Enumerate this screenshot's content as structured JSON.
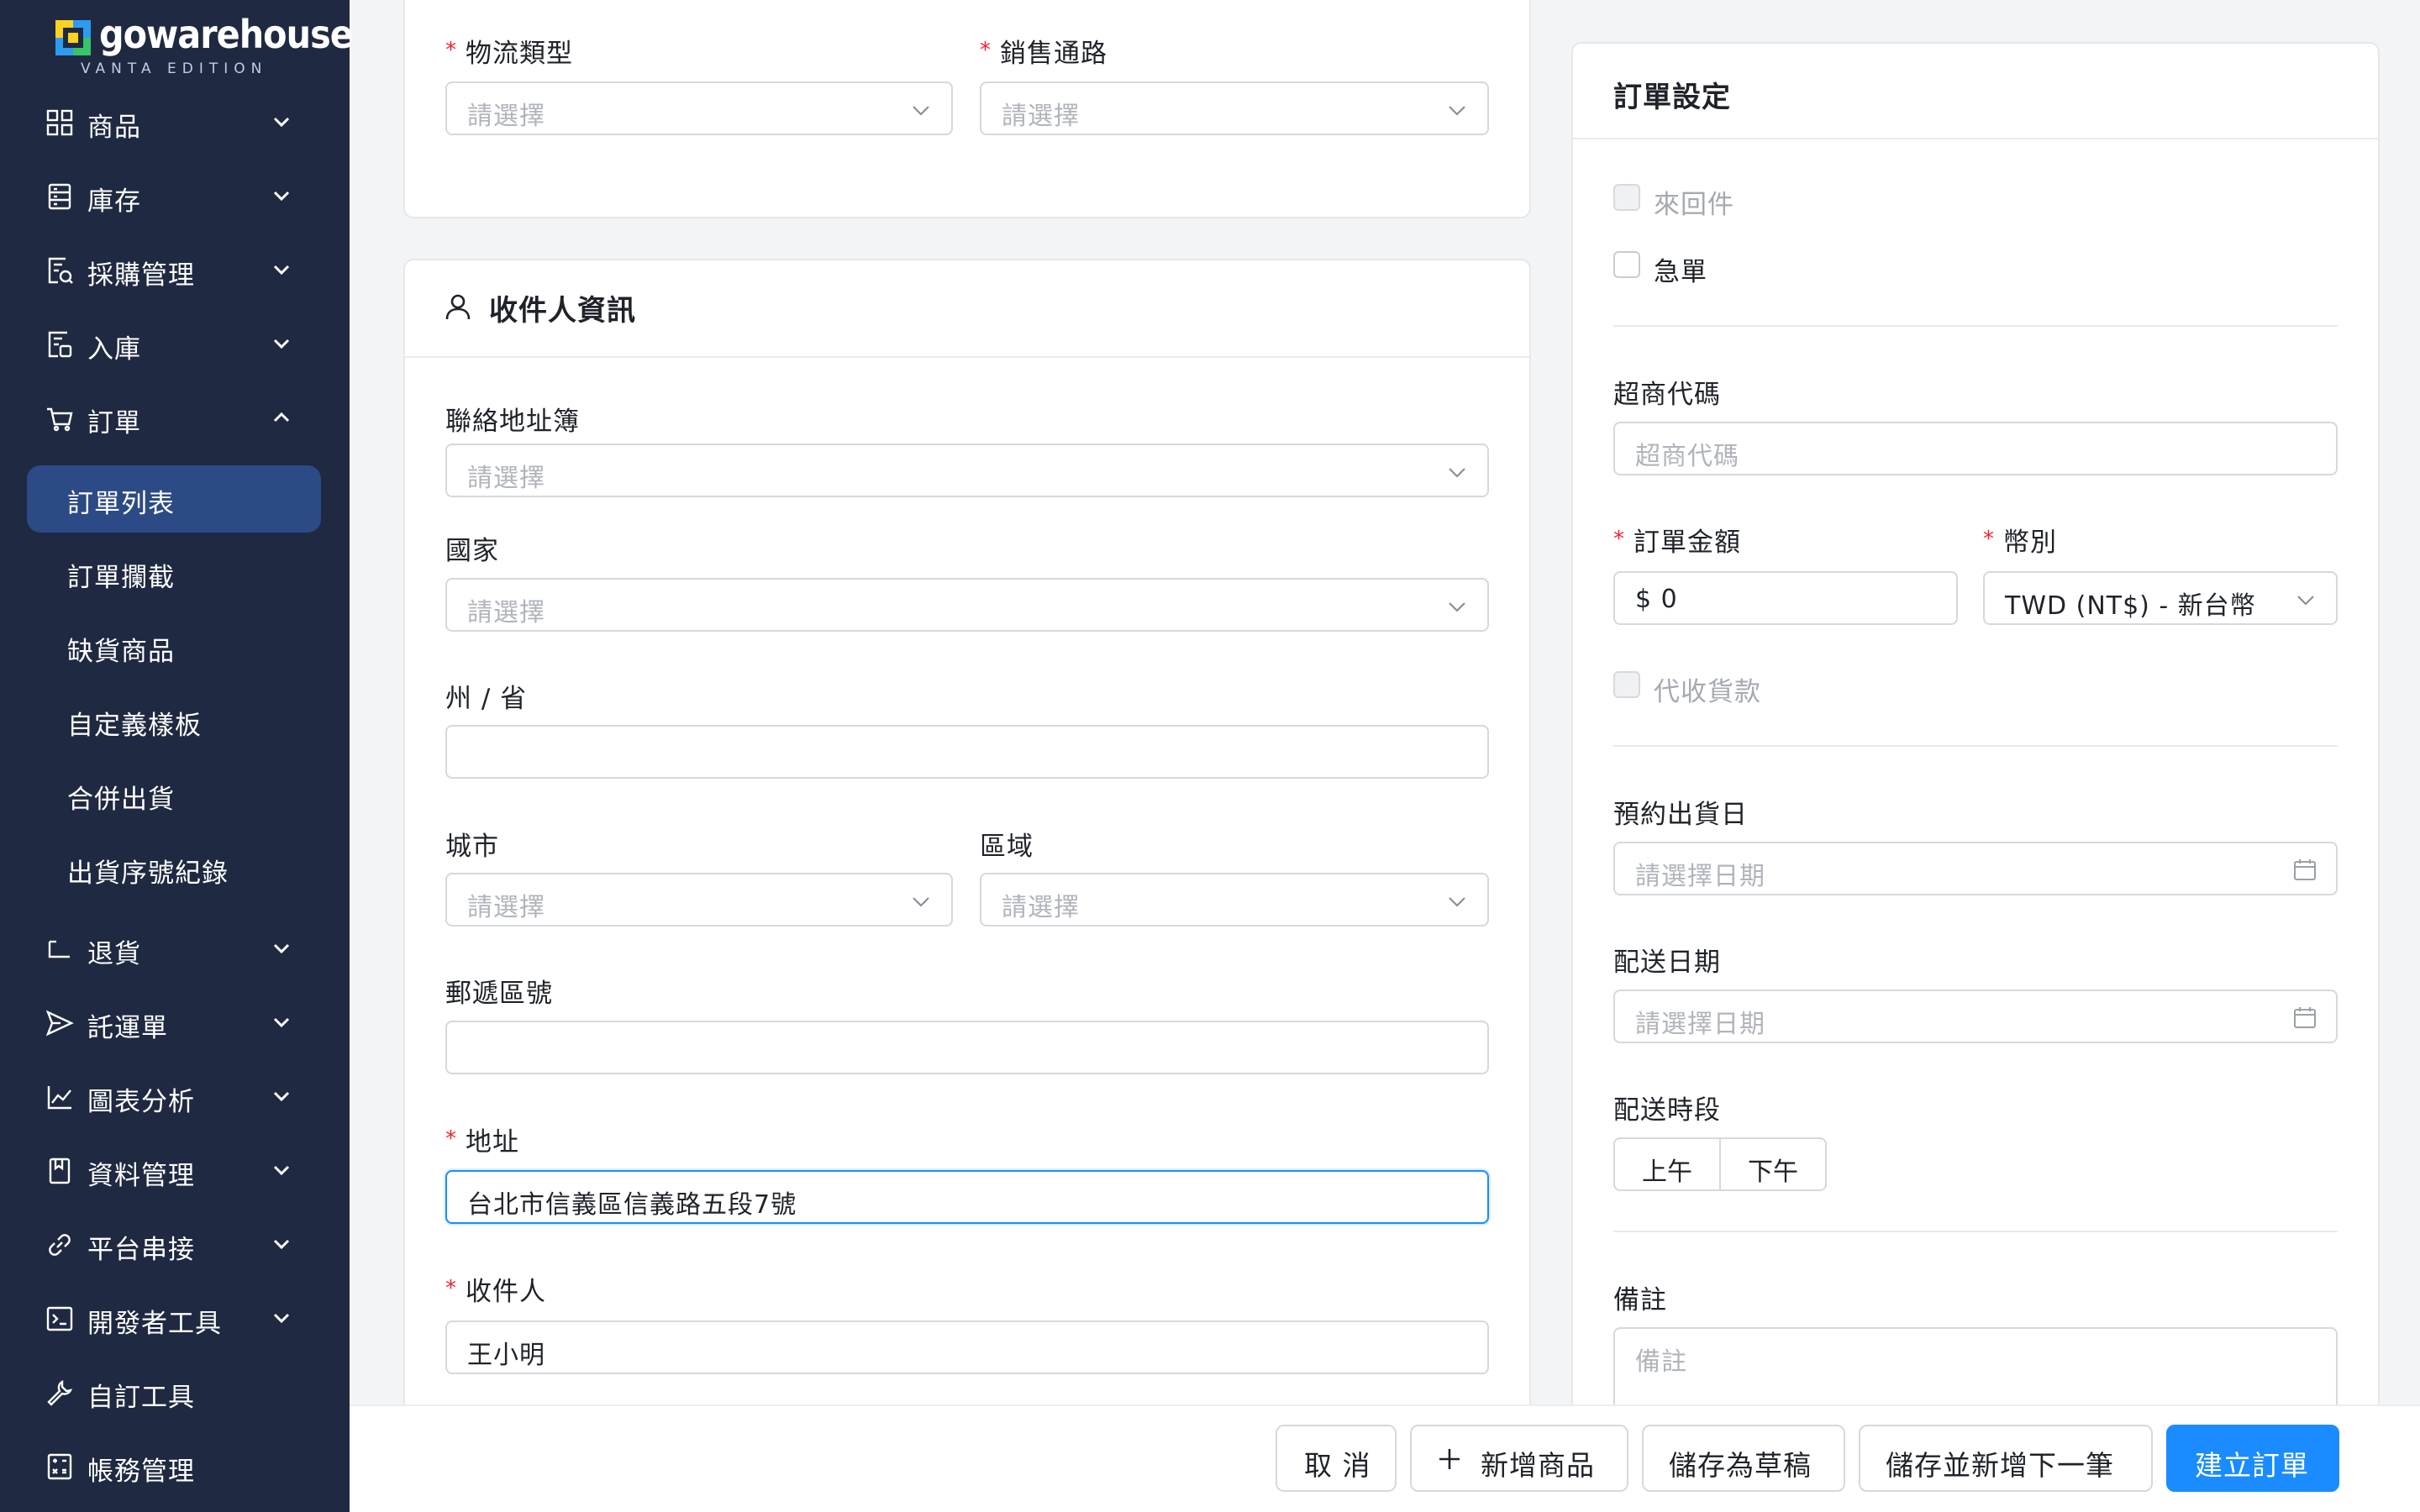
{
  "brand": {
    "name": "gowarehouse",
    "edition": "VANTA EDITION"
  },
  "sidebar": {
    "items": [
      {
        "label": "商品",
        "icon": "grid-icon"
      },
      {
        "label": "庫存",
        "icon": "inventory-icon"
      },
      {
        "label": "採購管理",
        "icon": "purchase-icon"
      },
      {
        "label": "入庫",
        "icon": "inbound-icon"
      },
      {
        "label": "訂單",
        "icon": "cart-icon"
      },
      {
        "label": "退貨",
        "icon": "return-icon"
      },
      {
        "label": "託運單",
        "icon": "send-icon"
      },
      {
        "label": "圖表分析",
        "icon": "chart-icon"
      },
      {
        "label": "資料管理",
        "icon": "book-icon"
      },
      {
        "label": "平台串接",
        "icon": "link-icon"
      },
      {
        "label": "開發者工具",
        "icon": "terminal-icon"
      },
      {
        "label": "自訂工具",
        "icon": "wrench-icon"
      },
      {
        "label": "帳務管理",
        "icon": "calculator-icon"
      }
    ],
    "order_sub": [
      "訂單列表",
      "訂單攔截",
      "缺貨商品",
      "自定義樣板",
      "合併出貨",
      "出貨序號紀錄"
    ]
  },
  "logistics": {
    "type_label": "物流類型",
    "type_placeholder": "請選擇",
    "channel_label": "銷售通路",
    "channel_placeholder": "請選擇"
  },
  "recipient": {
    "title": "收件人資訊",
    "addressbook_label": "聯絡地址簿",
    "addressbook_placeholder": "請選擇",
    "country_label": "國家",
    "country_placeholder": "請選擇",
    "state_label": "州 / 省",
    "state_value": "",
    "city_label": "城市",
    "city_placeholder": "請選擇",
    "district_label": "區域",
    "district_placeholder": "請選擇",
    "zip_label": "郵遞區號",
    "zip_value": "",
    "address_label": "地址",
    "address_value": "台北市信義區信義路五段7號",
    "name_label": "收件人",
    "name_value": "王小明"
  },
  "settings": {
    "title": "訂單設定",
    "round_trip_label": "來回件",
    "round_trip_checked": false,
    "round_trip_disabled": true,
    "urgent_label": "急單",
    "urgent_checked": false,
    "cvs_label": "超商代碼",
    "cvs_placeholder": "超商代碼",
    "amount_label": "訂單金額",
    "amount_value": "$ 0",
    "currency_label": "幣別",
    "currency_value": "TWD (NT$) - 新台幣",
    "cod_label": "代收貨款",
    "cod_checked": false,
    "cod_disabled": true,
    "ship_date_label": "預約出貨日",
    "ship_date_placeholder": "請選擇日期",
    "delivery_date_label": "配送日期",
    "delivery_date_placeholder": "請選擇日期",
    "slot_label": "配送時段",
    "slot_am": "上午",
    "slot_pm": "下午",
    "note_label": "備註",
    "note_placeholder": "備註"
  },
  "footer": {
    "cancel": "取 消",
    "add_product": "新增商品",
    "save_draft": "儲存為草稿",
    "save_and_new": "儲存並新增下一筆",
    "create": "建立訂單"
  },
  "colors": {
    "sidebar_bg": "#1f2941",
    "active_bg": "#2c4a85",
    "primary": "#1a8cff",
    "required": "#f5222d"
  }
}
